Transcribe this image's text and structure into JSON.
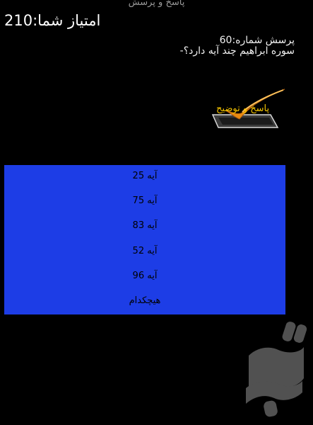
{
  "header": {
    "app_title": "پاسخ و پرسش",
    "score_text": "امتیاز شما:210"
  },
  "question": {
    "number_text": "پرسش شماره:60",
    "text": "-سوره ابراهیم چند آیه دارد؟"
  },
  "answer_button": {
    "label": "پاسخ و توضیح",
    "icon": "checkmark-icon",
    "label_color": "#f5c400"
  },
  "options": [
    "25 آیه",
    "75 آیه",
    "83 آیه",
    "52 آیه",
    "96 آیه",
    "هیچکدام"
  ],
  "colors": {
    "background": "#000000",
    "options_panel": "#1d3de6",
    "option_text": "#000000",
    "check_stroke": "#e88a12"
  },
  "store_logo": {
    "icon": "bazaar-logo-icon"
  }
}
